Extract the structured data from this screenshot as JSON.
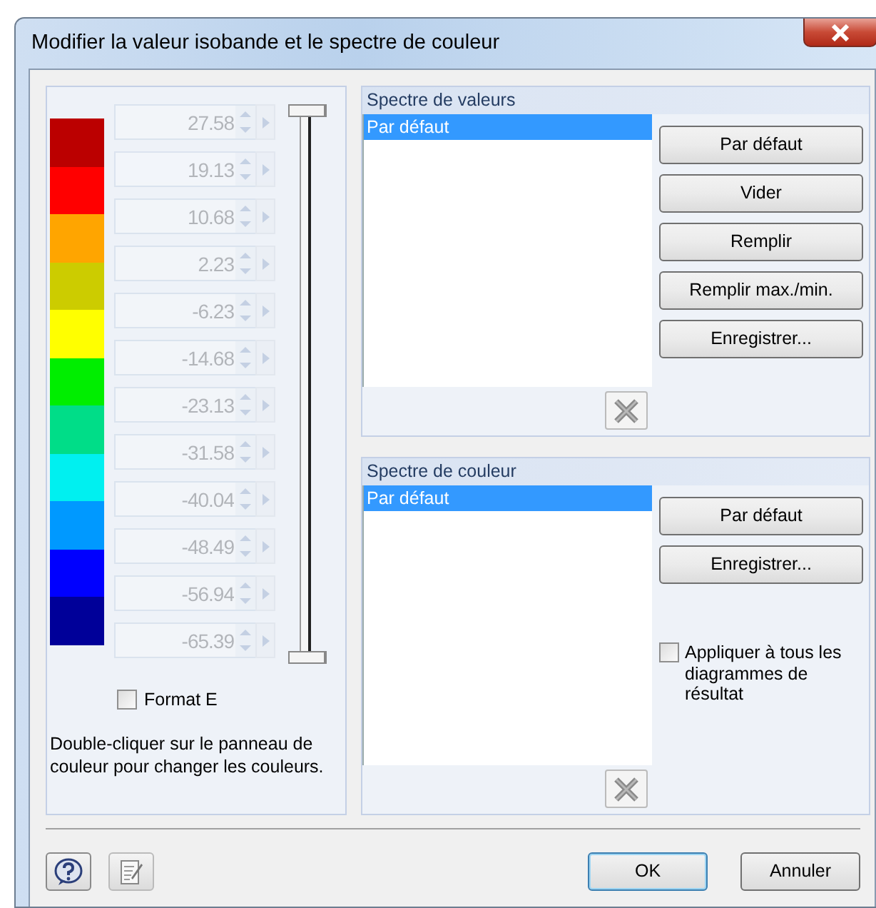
{
  "window": {
    "title": "Modifier la valeur isobande et le spectre de couleur"
  },
  "color_scale": {
    "colors": [
      {
        "color": "#bb0000"
      },
      {
        "color": "#ff0000"
      },
      {
        "color": "#ffa500"
      },
      {
        "color": "#cccc00"
      },
      {
        "color": "#ffff00"
      },
      {
        "color": "#00ee00"
      },
      {
        "color": "#00dd88"
      },
      {
        "color": "#00f0f0"
      },
      {
        "color": "#0099ff"
      },
      {
        "color": "#0000ff"
      },
      {
        "color": "#000099"
      }
    ],
    "values": [
      "27.58",
      "19.13",
      "10.68",
      "2.23",
      "-6.23",
      "-14.68",
      "-23.13",
      "-31.58",
      "-40.04",
      "-48.49",
      "-56.94",
      "-65.39"
    ],
    "format_e": {
      "label": "Format E",
      "checked": false
    },
    "hint": "Double-cliquer sur le panneau de couleur pour changer les couleurs."
  },
  "value_spectrum": {
    "title": "Spectre de valeurs",
    "items": [
      {
        "label": "Par défaut",
        "selected": true
      }
    ],
    "buttons": [
      "Par défaut",
      "Vider",
      "Remplir",
      "Remplir max./min.",
      "Enregistrer..."
    ],
    "delete_disabled": true
  },
  "color_spectrum": {
    "title": "Spectre de couleur",
    "items": [
      {
        "label": "Par défaut",
        "selected": true
      }
    ],
    "buttons": [
      "Par défaut",
      "Enregistrer..."
    ],
    "delete_disabled": true,
    "apply_all": {
      "label": "Appliquer à tous les diagrammes de résultat",
      "checked": false
    }
  },
  "footer": {
    "buttons": [
      {
        "label": "OK",
        "default": true
      },
      {
        "label": "Annuler",
        "default": false
      }
    ]
  }
}
